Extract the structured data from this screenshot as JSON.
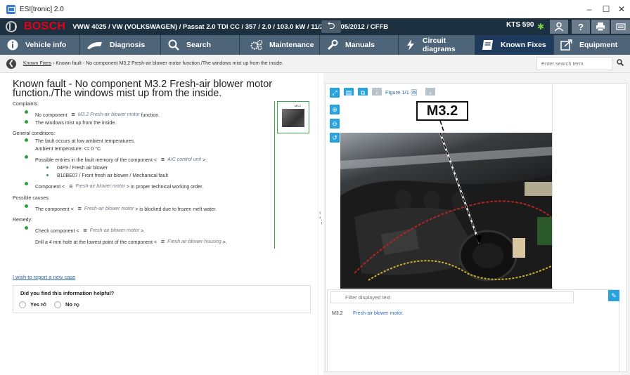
{
  "window": {
    "title": "ESI[tronic] 2.0",
    "minimize": "–",
    "maximize": "☐",
    "close": "✕"
  },
  "header": {
    "brand": "BOSCH",
    "vehicle": "VWW 4025 / VW (VOLKSWAGEN) / Passat 2.0 TDI CC / 357 / 2.0 / 103.0 kW / 11/2010 - 05/2012 / CFFB",
    "device": "KTS 590",
    "help_glyph": "?"
  },
  "nav": {
    "tabs": [
      {
        "label": "Vehicle info",
        "icon": "info-icon"
      },
      {
        "label": "Diagnosis",
        "icon": "diagnosis-icon"
      },
      {
        "label": "Search",
        "icon": "search-icon"
      },
      {
        "label": "Maintenance",
        "icon": "gears-icon"
      },
      {
        "label": "Manuals",
        "icon": "wrench-icon"
      },
      {
        "label": "Circuit diagrams",
        "icon": "lightning-icon"
      },
      {
        "label": "Known Fixes",
        "icon": "book-icon"
      },
      {
        "label": "Equipment",
        "icon": "equipment-icon"
      }
    ],
    "active": "Known Fixes"
  },
  "breadcrumb": {
    "link": "Known Fixes",
    "separator": " › ",
    "current": "Known fault - No component M3.2 Fresh-air blower motor function./The windows mist up from the inside.",
    "search_placeholder": "Enter search term"
  },
  "article": {
    "title": "Known fault - No component M3.2 Fresh-air blower motor function./The windows mist up from the inside.",
    "complaints_label": "Complaints:",
    "complaint_1_pre": "No component",
    "complaint_1_ref": "M3.2 Fresh-air blower motor",
    "complaint_1_post": "function.",
    "complaint_2": "The windows mist up from the inside.",
    "general_label": "General conditions:",
    "general_1a": "The fault occurs at low ambient temperatures.",
    "general_1b": "Ambient temperature: <= 0 °C",
    "general_2_pre": "Possible entries in the fault memory of the component <",
    "general_2_ref": "A/C control unit",
    "general_2_post": ">:",
    "sub_1": "04F9 / Fresh air blower",
    "sub_2": "B10BE07 / Front fresh air blower / Mechanical fault",
    "general_3_pre": "Component <",
    "general_3_ref": "Fresh-air blower motor",
    "general_3_post": "> in proper technical working order.",
    "causes_label": "Possible causes:",
    "cause_1_pre": "The component <",
    "cause_1_ref": "Fresh-air blower motor",
    "cause_1_post": "> is blocked due to frozen melt water.",
    "remedy_label": "Remedy:",
    "remedy_1_pre": "Check component <",
    "remedy_1_ref": "Fresh-air blower motor",
    "remedy_1_post": ">.",
    "remedy_2_pre": "Drill a 4 mm hole at the lowest point of the component <",
    "remedy_2_ref": "Fresh air blower housing",
    "remedy_2_post": ">.",
    "report_link": "I wish to report a new case",
    "helpful_question": "Did you find this information helpful?",
    "yes": "Yes",
    "no": "No",
    "menu_glyph": "≡",
    "thumb_label": "M3.2"
  },
  "figure": {
    "label": "Figure 1/1",
    "callout": "M3.2",
    "filter_placeholder": "Filter displayed text",
    "legend": [
      {
        "code": "M3.2",
        "desc": "Fresh-air blower motor."
      }
    ]
  },
  "colors": {
    "header_bg": "#1d3040",
    "nav_bg": "#4e6478",
    "nav_active": "#1e3a5c",
    "bosch_red": "#e30016",
    "bullet_green": "#2ea43a",
    "tool_blue": "#29a3dd"
  }
}
